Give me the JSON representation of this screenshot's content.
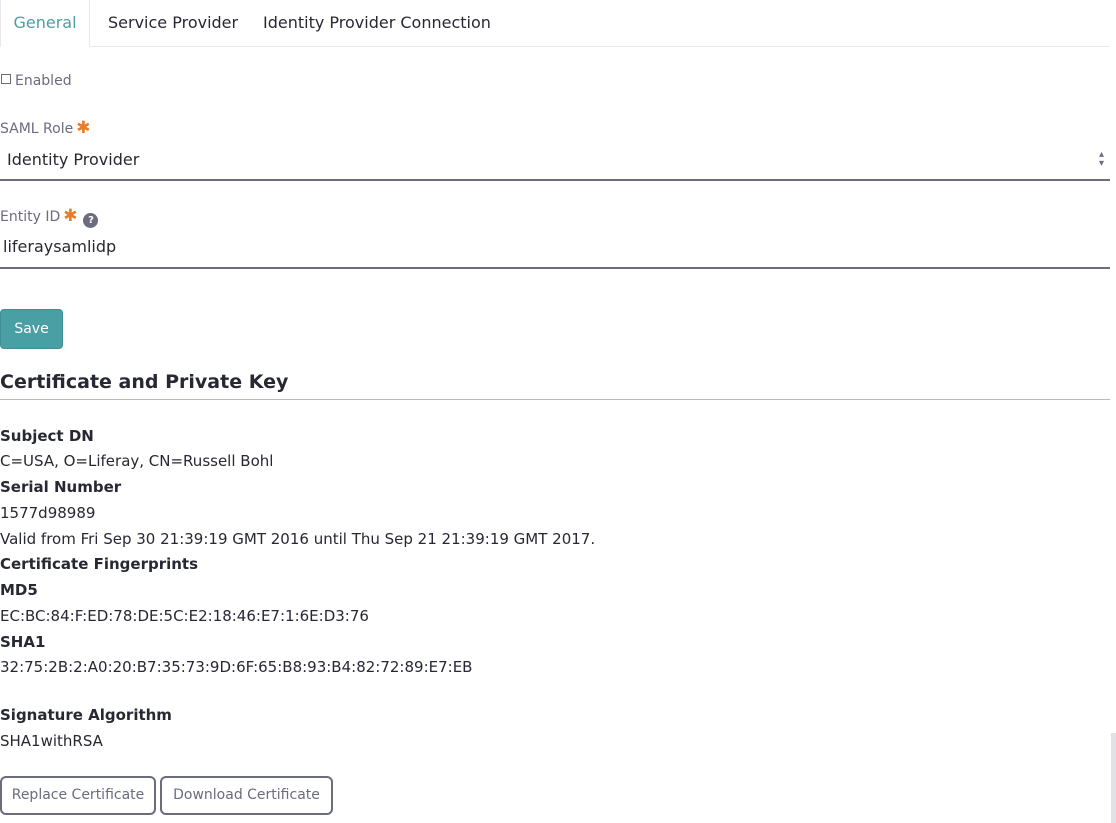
{
  "tabs": [
    {
      "label": "General",
      "active": true
    },
    {
      "label": "Service Provider",
      "active": false
    },
    {
      "label": "Identity Provider Connection",
      "active": false
    }
  ],
  "general": {
    "enabled_label": "Enabled",
    "enabled_checked": false,
    "saml_role": {
      "label": "SAML Role",
      "value": "Identity Provider"
    },
    "entity_id": {
      "label": "Entity ID",
      "value": "liferaysamlidp"
    },
    "save_label": "Save"
  },
  "certificate": {
    "title": "Certificate and Private Key",
    "subject_dn_label": "Subject DN",
    "subject_dn_value": "C=USA, O=Liferay, CN=Russell Bohl",
    "serial_number_label": "Serial Number",
    "serial_number_value": "1577d98989",
    "validity": "Valid from Fri Sep 30 21:39:19 GMT 2016 until Thu Sep 21 21:39:19 GMT 2017.",
    "fingerprints_label": "Certificate Fingerprints",
    "md5_label": "MD5",
    "md5_value": "EC:BC:84:F:ED:78:DE:5C:E2:18:46:E7:1:6E:D3:76",
    "sha1_label": "SHA1",
    "sha1_value": "32:75:2B:2:A0:20:B7:35:73:9D:6F:65:B8:93:B4:82:72:89:E7:EB",
    "signature_algorithm_label": "Signature Algorithm",
    "signature_algorithm_value": "SHA1withRSA",
    "replace_label": "Replace Certificate",
    "download_label": "Download Certificate"
  },
  "icons": {
    "required": "asterisk-icon",
    "help": "question-circle-icon",
    "select": "caret-double-icon"
  },
  "colors": {
    "accent": "#4a9fa5",
    "required": "#e87b28",
    "secondary_text": "#6b6c7e"
  }
}
